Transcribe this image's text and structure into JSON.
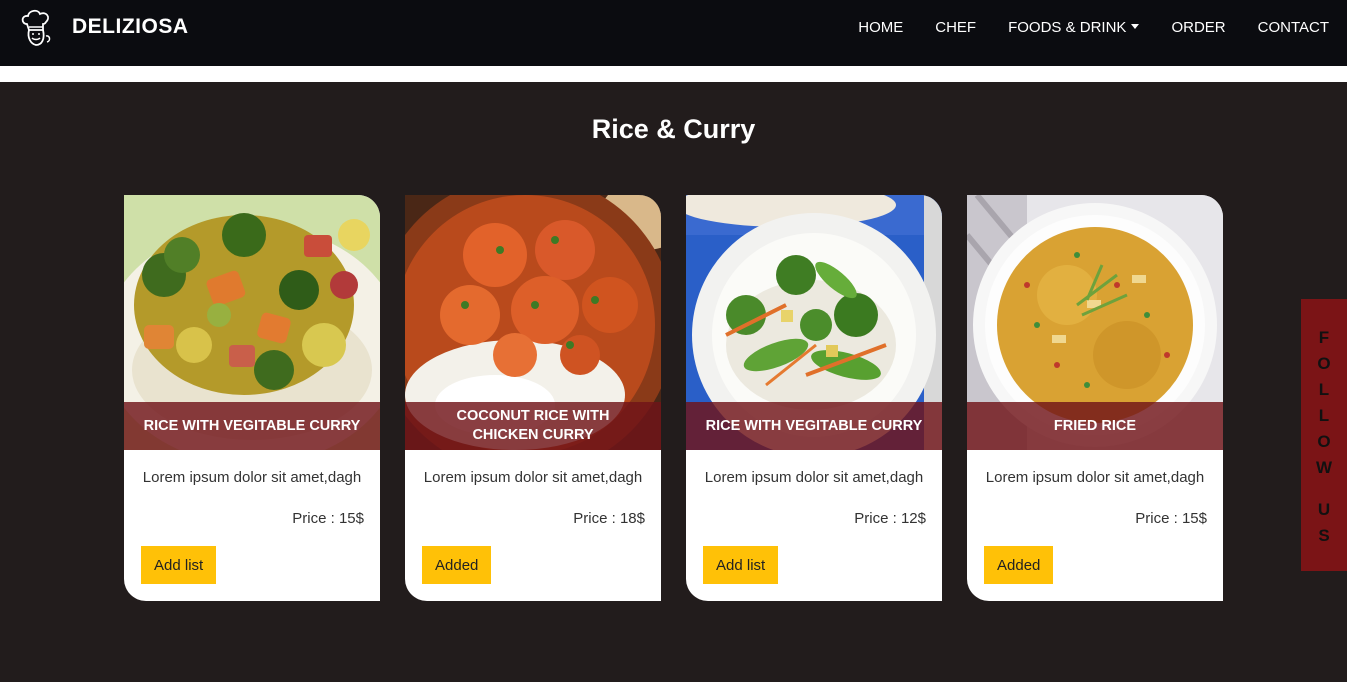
{
  "header": {
    "brand": "DELIZIOSA",
    "logo_icon": "chef-hat-icon",
    "nav": [
      {
        "label": "HOME"
      },
      {
        "label": "CHEF"
      },
      {
        "label": "FOODS & DRINK",
        "has_dropdown": true
      },
      {
        "label": "ORDER"
      },
      {
        "label": "CONTACT"
      }
    ]
  },
  "section": {
    "title": "Rice & Curry"
  },
  "cards": [
    {
      "title": "RICE WITH VEGITABLE CURRY",
      "description": "Lorem ipsum dolor sit amet,dagh",
      "price": "Price : 15$",
      "button": "Add list",
      "image": "vegetable-curry-photo"
    },
    {
      "title": "COCONUT RICE WITH CHICKEN CURRY",
      "description": "Lorem ipsum dolor sit amet,dagh",
      "price": "Price : 18$",
      "button": "Added",
      "image": "chicken-curry-photo"
    },
    {
      "title": "RICE WITH VEGITABLE CURRY",
      "description": "Lorem ipsum dolor sit amet,dagh",
      "price": "Price : 12$",
      "button": "Add list",
      "image": "vegetable-stirfry-photo"
    },
    {
      "title": "FRIED RICE",
      "description": "Lorem ipsum dolor sit amet,dagh",
      "price": "Price : 15$",
      "button": "Added",
      "image": "fried-rice-photo"
    }
  ],
  "follow": {
    "letters": [
      "F",
      "O",
      "L",
      "L",
      "O",
      "W",
      "U",
      "S"
    ]
  },
  "colors": {
    "navbar": "#0b0c10",
    "background": "#221c1c",
    "caption": "#701418",
    "button": "#ffc107",
    "follow_tab": "#7b1416"
  }
}
